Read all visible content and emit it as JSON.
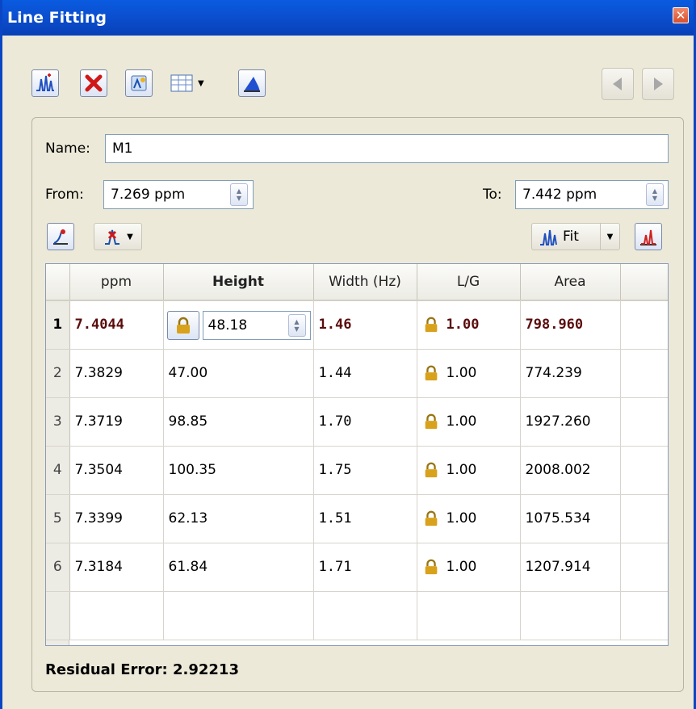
{
  "window": {
    "title": "Line Fitting"
  },
  "form": {
    "name_label": "Name:",
    "name_value": "M1",
    "from_label": "From:",
    "from_value": "7.269 ppm",
    "to_label": "To:",
    "to_value": "7.442 ppm"
  },
  "toolbar": {
    "fit_label": "Fit"
  },
  "table": {
    "columns": [
      "ppm",
      "Height",
      "Width (Hz)",
      "L/G",
      "Area"
    ],
    "rows": [
      {
        "n": "1",
        "ppm": "7.4044",
        "height": "48.18",
        "width": "1.46",
        "lg": "1.00",
        "area": "798.960"
      },
      {
        "n": "2",
        "ppm": "7.3829",
        "height": "47.00",
        "width": "1.44",
        "lg": "1.00",
        "area": "774.239"
      },
      {
        "n": "3",
        "ppm": "7.3719",
        "height": "98.85",
        "width": "1.70",
        "lg": "1.00",
        "area": "1927.260"
      },
      {
        "n": "4",
        "ppm": "7.3504",
        "height": "100.35",
        "width": "1.75",
        "lg": "1.00",
        "area": "2008.002"
      },
      {
        "n": "5",
        "ppm": "7.3399",
        "height": "62.13",
        "width": "1.51",
        "lg": "1.00",
        "area": "1075.534"
      },
      {
        "n": "6",
        "ppm": "7.3184",
        "height": "61.84",
        "width": "1.71",
        "lg": "1.00",
        "area": "1207.914"
      }
    ]
  },
  "residual": {
    "text": "Residual Error: 2.92213"
  },
  "colors": {
    "titlebar": "#0b4fd0",
    "selected_text": "#5a0c0c",
    "lock_gold": "#d9a21c"
  }
}
